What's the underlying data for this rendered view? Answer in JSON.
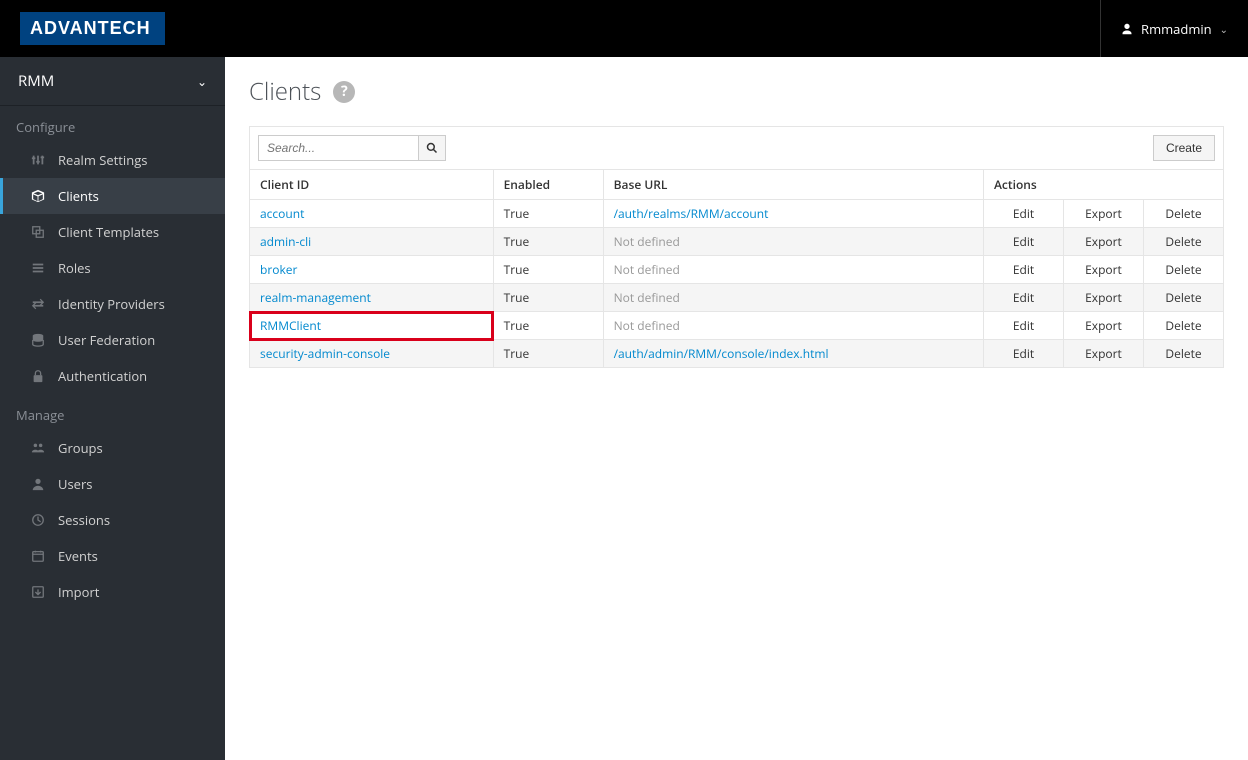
{
  "brand": "ADVANTECH",
  "user": {
    "name": "Rmmadmin"
  },
  "realm": "RMM",
  "sections": {
    "configure": {
      "label": "Configure",
      "items": [
        {
          "key": "realm-settings",
          "label": "Realm Settings"
        },
        {
          "key": "clients",
          "label": "Clients"
        },
        {
          "key": "client-templates",
          "label": "Client Templates"
        },
        {
          "key": "roles",
          "label": "Roles"
        },
        {
          "key": "identity-providers",
          "label": "Identity Providers"
        },
        {
          "key": "user-federation",
          "label": "User Federation"
        },
        {
          "key": "authentication",
          "label": "Authentication"
        }
      ]
    },
    "manage": {
      "label": "Manage",
      "items": [
        {
          "key": "groups",
          "label": "Groups"
        },
        {
          "key": "users",
          "label": "Users"
        },
        {
          "key": "sessions",
          "label": "Sessions"
        },
        {
          "key": "events",
          "label": "Events"
        },
        {
          "key": "import",
          "label": "Import"
        }
      ]
    }
  },
  "page": {
    "title": "Clients",
    "search_placeholder": "Search...",
    "create_label": "Create",
    "columns": {
      "client_id": "Client ID",
      "enabled": "Enabled",
      "base_url": "Base URL",
      "actions": "Actions"
    },
    "action_labels": {
      "edit": "Edit",
      "export": "Export",
      "delete": "Delete"
    },
    "not_defined": "Not defined",
    "clients": [
      {
        "id": "account",
        "enabled": "True",
        "base_url": "/auth/realms/RMM/account",
        "url_defined": true
      },
      {
        "id": "admin-cli",
        "enabled": "True",
        "base_url": "Not defined",
        "url_defined": false
      },
      {
        "id": "broker",
        "enabled": "True",
        "base_url": "Not defined",
        "url_defined": false
      },
      {
        "id": "realm-management",
        "enabled": "True",
        "base_url": "Not defined",
        "url_defined": false
      },
      {
        "id": "RMMClient",
        "enabled": "True",
        "base_url": "Not defined",
        "url_defined": false,
        "highlight": true
      },
      {
        "id": "security-admin-console",
        "enabled": "True",
        "base_url": "/auth/admin/RMM/console/index.html",
        "url_defined": true
      }
    ]
  }
}
